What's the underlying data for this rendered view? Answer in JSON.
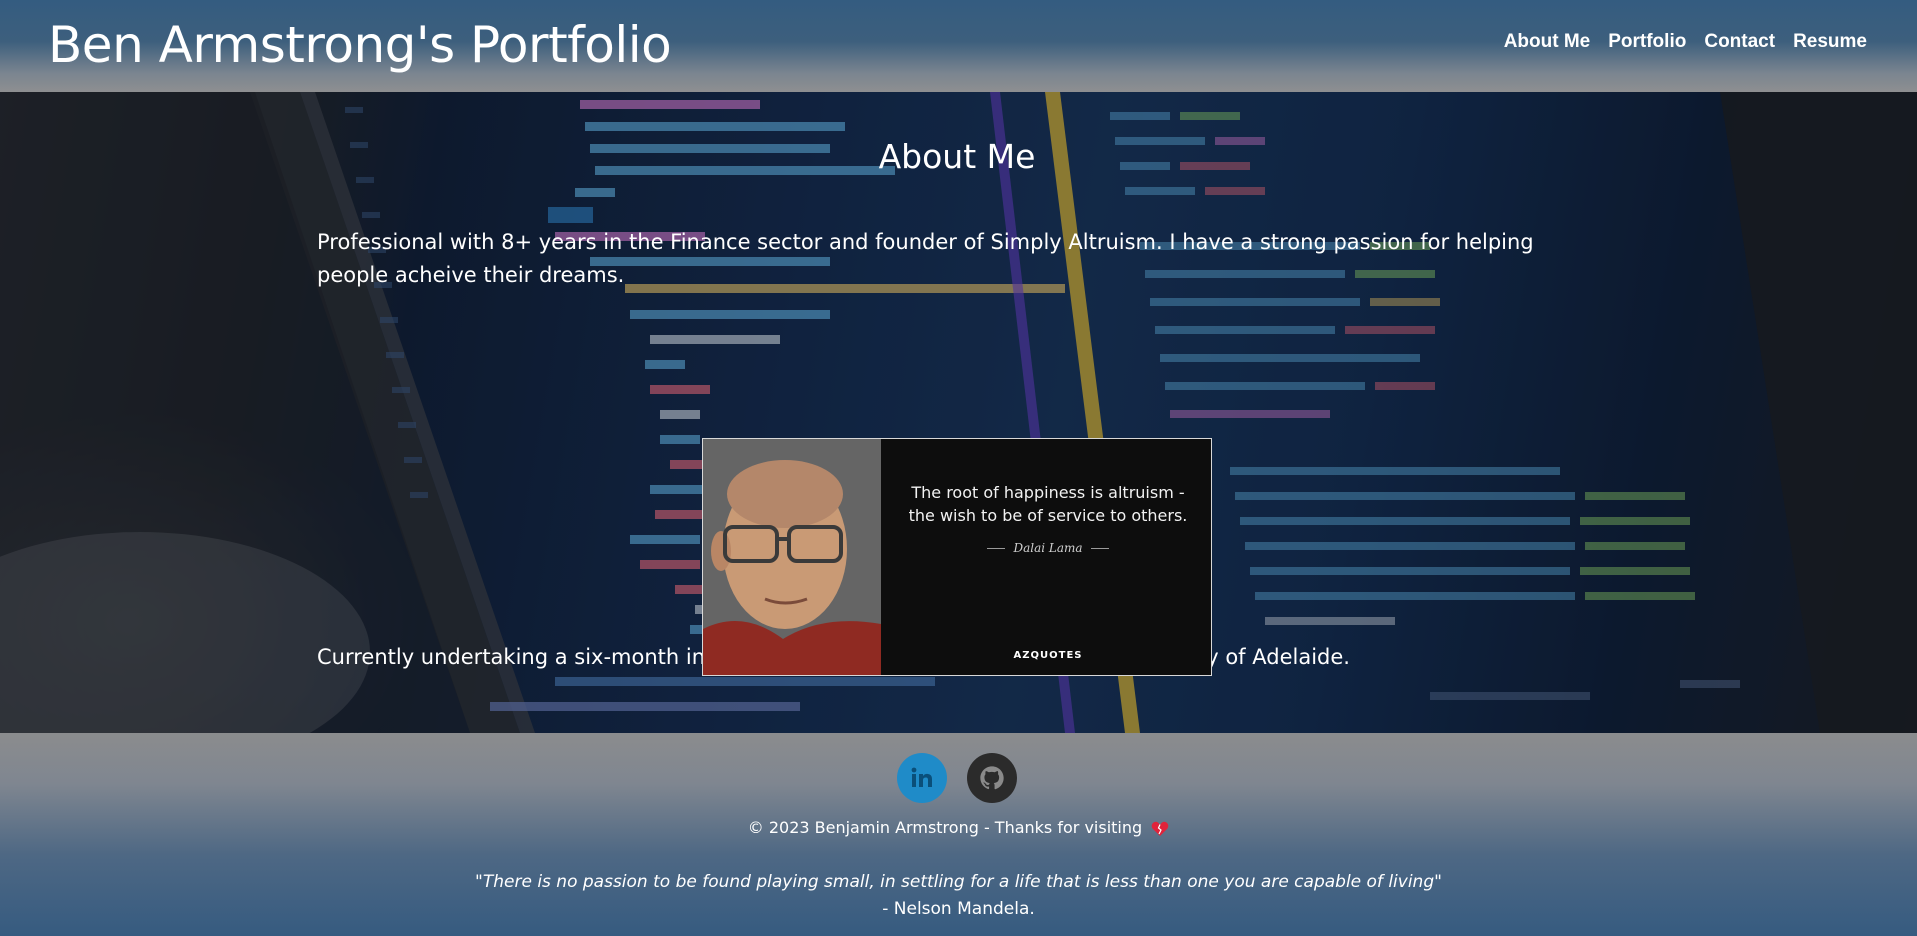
{
  "header": {
    "title": "Ben Armstrong's Portfolio",
    "nav": [
      "About Me",
      "Portfolio",
      "Contact",
      "Resume"
    ]
  },
  "hero": {
    "heading": "About Me",
    "paragraph1": "Professional with 8+ years in the Finance sector and founder of Simply Altruism. I have a strong passion for helping people acheive their dreams.",
    "paragraph2": "Currently undertaking a six-month intensive Coding Bootcamp Course with University of Adelaide.",
    "background_image": "code-on-laptop-screen",
    "quote_image": {
      "text": "The root of happiness is altruism - the wish to be of service to others.",
      "author": "Dalai Lama",
      "brand": "AZQUOTES"
    }
  },
  "footer": {
    "social": [
      {
        "name": "linkedin",
        "icon": "linkedin-icon",
        "color": "#1f8bc8",
        "label": "in"
      },
      {
        "name": "github",
        "icon": "github-icon",
        "color": "#2b2b2b"
      }
    ],
    "copyright": "© 2023 Benjamin Armstrong - Thanks for visiting",
    "quote": "\"There is no passion to be found playing small, in settling for a life that is less than one you are capable of living\"",
    "quote_author": "- Nelson Mandela."
  },
  "colors": {
    "header_top": "#345c80",
    "footer_bottom": "#365b80",
    "text": "#ffffff",
    "linkedin": "#1f8bc8"
  }
}
